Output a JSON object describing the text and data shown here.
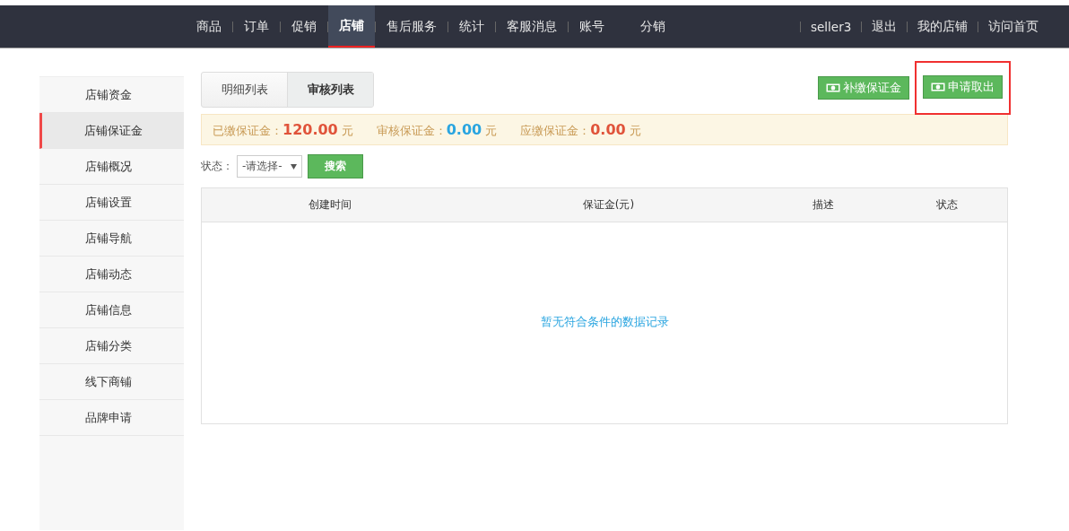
{
  "nav": {
    "items": [
      {
        "label": "商品",
        "selected": false,
        "separator": true
      },
      {
        "label": "订单",
        "selected": false,
        "separator": true
      },
      {
        "label": "促销",
        "selected": false,
        "separator": true
      },
      {
        "label": "店铺",
        "selected": true,
        "separator": true
      },
      {
        "label": "售后服务",
        "selected": false,
        "separator": true
      },
      {
        "label": "统计",
        "selected": false,
        "separator": true
      },
      {
        "label": "客服消息",
        "selected": false,
        "separator": true
      },
      {
        "label": "账号",
        "selected": false,
        "separator": false
      },
      {
        "label": "分销",
        "selected": false,
        "separator": false
      }
    ],
    "user_links": [
      "seller3",
      "退出",
      "我的店铺",
      "访问首页"
    ]
  },
  "sidebar": {
    "items": [
      {
        "label": "店铺资金",
        "selected": false
      },
      {
        "label": "店铺保证金",
        "selected": true
      },
      {
        "label": "店铺概况",
        "selected": false
      },
      {
        "label": "店铺设置",
        "selected": false
      },
      {
        "label": "店铺导航",
        "selected": false
      },
      {
        "label": "店铺动态",
        "selected": false
      },
      {
        "label": "店铺信息",
        "selected": false
      },
      {
        "label": "店铺分类",
        "selected": false
      },
      {
        "label": "线下商铺",
        "selected": false
      },
      {
        "label": "品牌申请",
        "selected": false
      }
    ]
  },
  "tabs": [
    {
      "label": "明细列表",
      "selected": false
    },
    {
      "label": "审核列表",
      "selected": true
    }
  ],
  "actions": [
    {
      "label": "补缴保证金",
      "highlighted": false
    },
    {
      "label": "申请取出",
      "highlighted": true
    }
  ],
  "summary": [
    {
      "label": "已缴保证金：",
      "amount": "120.00",
      "unit": "元",
      "color": "#e0533a"
    },
    {
      "label": "审核保证金：",
      "amount": "0.00",
      "unit": "元",
      "color": "#2aa5e0"
    },
    {
      "label": "应缴保证金：",
      "amount": "0.00",
      "unit": "元",
      "color": "#e0533a"
    }
  ],
  "filter": {
    "label": "状态：",
    "select_value": "-请选择-",
    "button": "搜索"
  },
  "table": {
    "columns": [
      "创建时间",
      "保证金(元)",
      "描述",
      "状态"
    ],
    "empty_message": "暂无符合条件的数据记录"
  }
}
